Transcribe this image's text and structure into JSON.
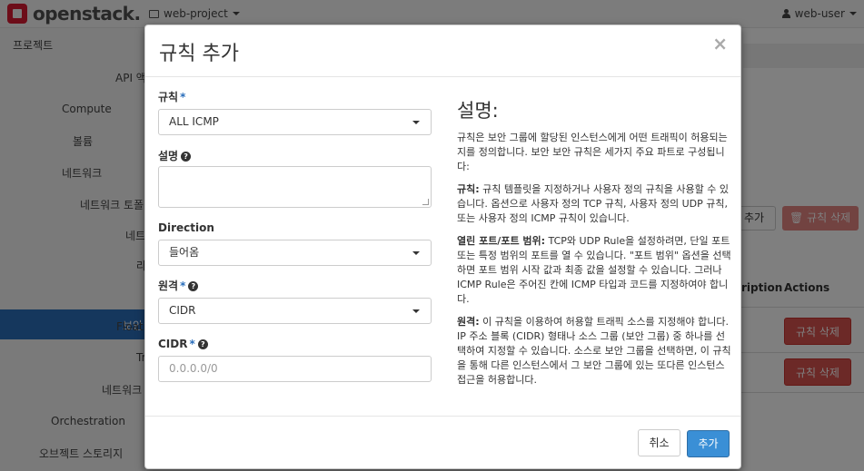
{
  "navbar": {
    "brand": "openstack.",
    "project": "web-project",
    "user": "web-user"
  },
  "sidebar": {
    "items": [
      {
        "label": "프로젝트"
      },
      {
        "label": "API 액"
      },
      {
        "label": "Compute"
      },
      {
        "label": "볼륨"
      },
      {
        "label": "네트워크"
      },
      {
        "label": "네트워크 토폴"
      },
      {
        "label": "네트"
      },
      {
        "label": "라"
      },
      {
        "label": "보안"
      },
      {
        "label": "Floati"
      },
      {
        "label": "Tr"
      },
      {
        "label": "네트워크"
      },
      {
        "label": "Orchestration"
      },
      {
        "label": "오브젝트 스토리지"
      }
    ]
  },
  "background": {
    "add_button": "추가",
    "delete_button": "규칙 삭제",
    "col_description": "ription",
    "col_actions": "Actions",
    "row_delete": "규칙 삭제"
  },
  "modal": {
    "title": "규칙 추가",
    "close": "×",
    "rule_label": "규칙",
    "rule_value": "ALL ICMP",
    "description_label": "설명",
    "direction_label": "Direction",
    "direction_value": "들어옴",
    "remote_label": "원격",
    "remote_value": "CIDR",
    "cidr_label": "CIDR",
    "cidr_placeholder": "0.0.0.0/0",
    "required_mark": "*",
    "help_mark": "?",
    "help": {
      "title": "설명:",
      "intro": "규칙은 보안 그룹에 할당된 인스턴스에게 어떤 트래픽이 허용되는지를 정의합니다. 보안 보안 규칙은 세가지 주요 파트로 구성됩니다:",
      "rule_head": "규칙:",
      "rule_body": " 규칙 템플릿을 지정하거나 사용자 정의 규칙을 사용할 수 있습니다. 옵션으로 사용자 정의 TCP 규칙, 사용자 정의 UDP 규칙, 또는 사용자 정의 ICMP 규칙이 있습니다.",
      "port_head": "열린 포트/포트 범위:",
      "port_body": " TCP와 UDP Rule을 설정하려면, 단일 포트 또는 특정 범위의 포트를 열 수 있습니다. \"포트 범위\" 옵션을 선택하면 포트 범위 시작 값과 최종 값을 설정할 수 있습니다. 그러나 ICMP Rule은 주어진 칸에 ICMP 타입과 코드를 지정하여야 합니다.",
      "remote_head": "원격:",
      "remote_body": " 이 규칙을 이용하여 허용할 트래픽 소스를 지정해야 합니다. IP 주소 블록 (CIDR) 형태나 소스 그룹 (보안 그룹) 중 하나를 선택하여 지정할 수 있습니다. 소스로 보안 그룹을 선택하면, 이 규칙을 통해 다른 인스턴스에서 그 보안 그룹에 있는 또다른 인스턴스 접근을 허용합니다."
    },
    "cancel_button": "취소",
    "add_button": "추가"
  }
}
